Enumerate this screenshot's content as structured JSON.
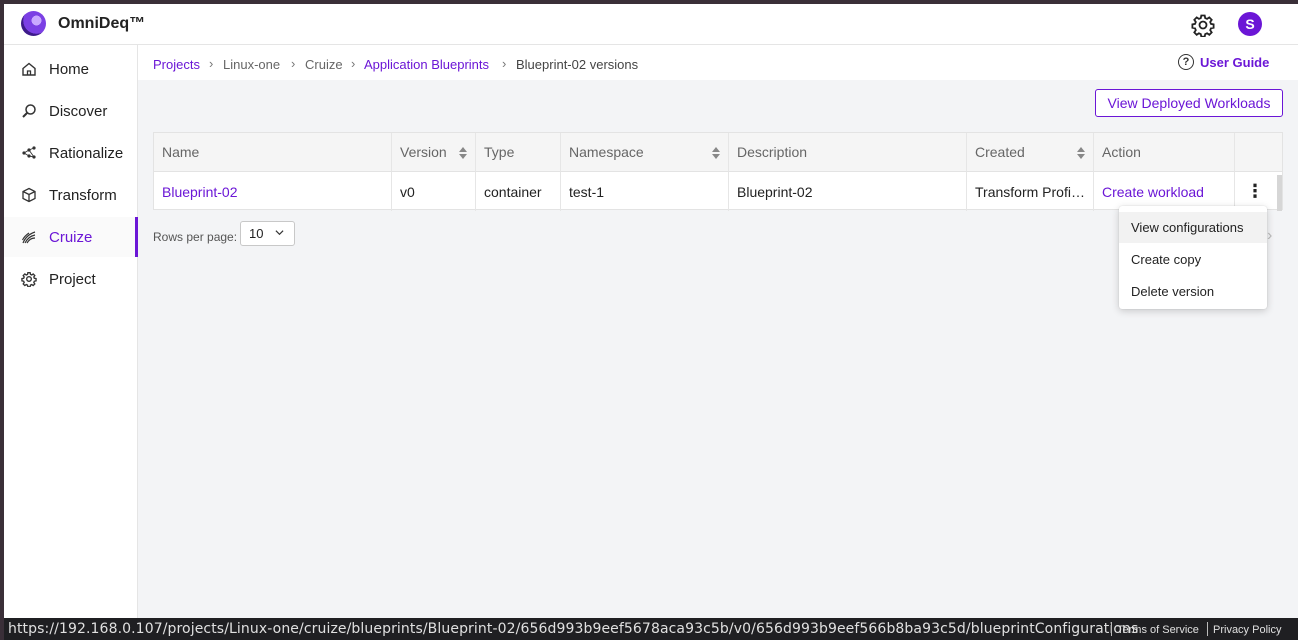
{
  "app": {
    "brand": "OmniDeq™",
    "avatar_initial": "S",
    "accent_color": "#6b16d6"
  },
  "sidebar": {
    "items": [
      {
        "label": "Home",
        "icon": "home-icon"
      },
      {
        "label": "Discover",
        "icon": "discover-icon"
      },
      {
        "label": "Rationalize",
        "icon": "rationalize-icon"
      },
      {
        "label": "Transform",
        "icon": "cube-icon"
      },
      {
        "label": "Cruize",
        "icon": "cruize-icon",
        "active": true
      },
      {
        "label": "Project",
        "icon": "gear-icon"
      }
    ]
  },
  "breadcrumb": {
    "items": [
      "Projects",
      "Linux-one",
      "Cruize",
      "Application Blueprints",
      "Blueprint-02 versions"
    ],
    "user_guide": "User Guide"
  },
  "toolbar": {
    "view_deployed": "View Deployed Workloads"
  },
  "table": {
    "headers": [
      "Name",
      "Version",
      "Type",
      "Namespace",
      "Description",
      "Created",
      "Action"
    ],
    "rows": [
      {
        "name": "Blueprint-02",
        "version": "v0",
        "type": "container",
        "namespace": "test-1",
        "description": "Blueprint-02",
        "created": "Transform Profi…",
        "action": "Create workload"
      }
    ]
  },
  "pagination": {
    "rows_per_page_label": "Rows per page:",
    "rows_per_page_value": "10"
  },
  "context_menu": {
    "items": [
      "View configurations",
      "Create copy",
      "Delete version"
    ]
  },
  "statusbar": {
    "url": "https://192.168.0.107/projects/Linux-one/cruize/blueprints/Blueprint-02/656d993b9eef5678aca93c5b/v0/656d993b9eef566b8ba93c5d/blueprintConfigurations",
    "terms": "Terms of Service",
    "privacy": "Privacy Policy"
  }
}
